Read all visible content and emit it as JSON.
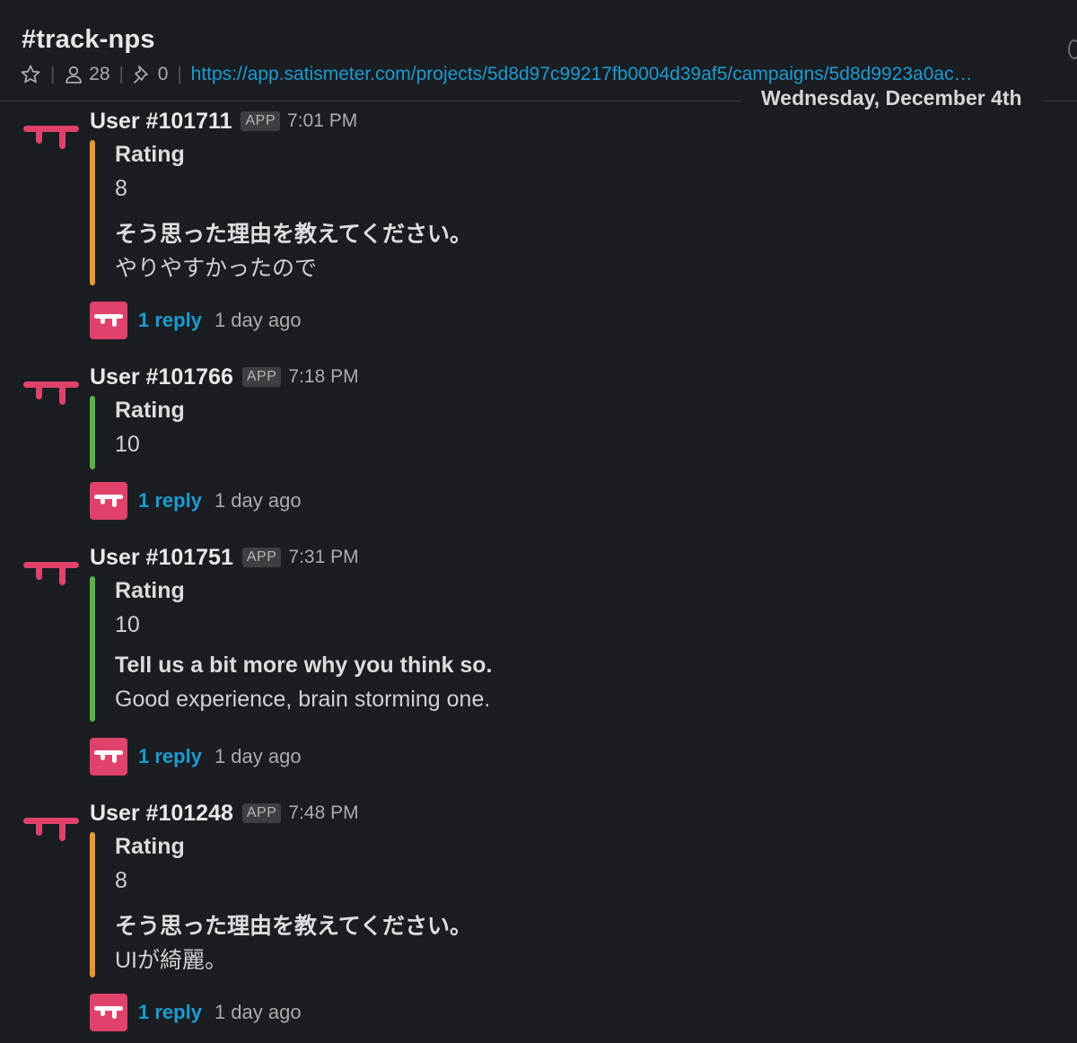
{
  "header": {
    "channel": "#track-nps",
    "members": "28",
    "pins": "0",
    "topic_link": "https://app.satismeter.com/projects/5d8d97c99217fb0004d39af5/campaigns/5d8d9923a0ac…",
    "date_divider": "Wednesday, December 4th"
  },
  "app_badge": "APP",
  "colors": {
    "orange": "#e8962f",
    "green": "#5bb347",
    "brand_pink": "#e0426c",
    "link": "#1d9bd1"
  },
  "messages": [
    {
      "user": "User #101711",
      "time": "7:01 PM",
      "accent": "orange",
      "rating_label": "Rating",
      "rating": "8",
      "question": "そう思った理由を教えてください。",
      "answer": "やりやすかったので",
      "reply_link": "1 reply",
      "reply_ago": "1 day ago"
    },
    {
      "user": "User #101766",
      "time": "7:18 PM",
      "accent": "green",
      "rating_label": "Rating",
      "rating": "10",
      "reply_link": "1 reply",
      "reply_ago": "1 day ago"
    },
    {
      "user": "User #101751",
      "time": "7:31 PM",
      "accent": "green",
      "rating_label": "Rating",
      "rating": "10",
      "question": "Tell us a bit more why you think so.",
      "answer": "Good experience, brain storming one.",
      "reply_link": "1 reply",
      "reply_ago": "1 day ago"
    },
    {
      "user": "User #101248",
      "time": "7:48 PM",
      "accent": "orange",
      "rating_label": "Rating",
      "rating": "8",
      "question": "そう思った理由を教えてください。",
      "answer": "UIが綺麗。",
      "reply_link": "1 reply",
      "reply_ago": "1 day ago"
    }
  ]
}
